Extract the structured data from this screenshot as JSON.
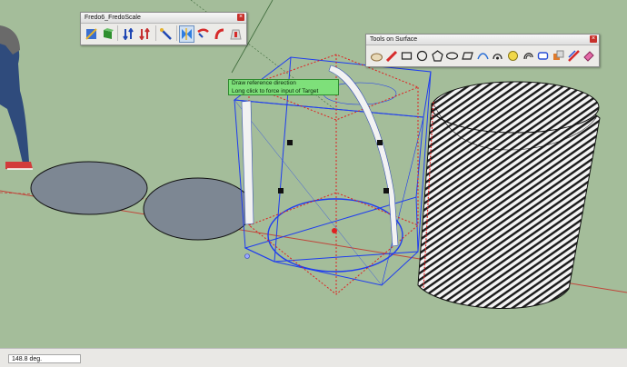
{
  "viewport": {
    "background": "#a4bd9a",
    "tooltip": {
      "line1": "Draw reference direction",
      "line2": "Long click to force input of Target"
    }
  },
  "toolbars": {
    "fredoscale": {
      "title": "Fredo6_FredoScale",
      "tools": [
        {
          "icon": "scale-tool-icon"
        },
        {
          "icon": "box-stretch-icon"
        },
        {
          "icon": "shear-icon"
        },
        {
          "icon": "planar-shear-icon"
        },
        {
          "icon": "stretch-icon"
        },
        {
          "icon": "twist-icon"
        },
        {
          "icon": "radial-bend-icon"
        },
        {
          "icon": "bend-icon"
        },
        {
          "icon": "taper-icon"
        }
      ]
    },
    "tools_on_surface": {
      "title": "Tools on Surface",
      "tools": [
        {
          "icon": "surface-eraser-icon"
        },
        {
          "icon": "surface-pencil-icon"
        },
        {
          "icon": "surface-rectangle-icon"
        },
        {
          "icon": "surface-circle-icon"
        },
        {
          "icon": "surface-polygon-icon"
        },
        {
          "icon": "surface-ellipse-icon"
        },
        {
          "icon": "surface-parallelogram-icon"
        },
        {
          "icon": "surface-arc-icon"
        },
        {
          "icon": "surface-text-icon"
        },
        {
          "icon": "surface-freehand-icon"
        },
        {
          "icon": "surface-offset-icon"
        },
        {
          "icon": "surface-protractor-icon"
        },
        {
          "icon": "surface-make-face-icon"
        },
        {
          "icon": "surface-line-icon"
        },
        {
          "icon": "surface-eraser2-icon"
        }
      ]
    }
  },
  "statusbar": {
    "measurement_value": "148.8 deg."
  }
}
